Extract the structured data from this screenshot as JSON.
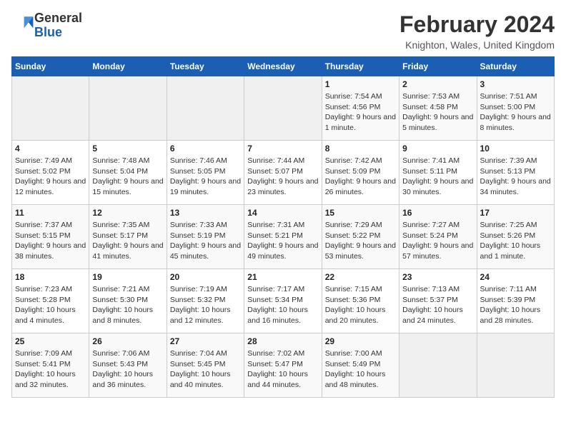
{
  "header": {
    "logo_general": "General",
    "logo_blue": "Blue",
    "month_title": "February 2024",
    "location": "Knighton, Wales, United Kingdom"
  },
  "days_of_week": [
    "Sunday",
    "Monday",
    "Tuesday",
    "Wednesday",
    "Thursday",
    "Friday",
    "Saturday"
  ],
  "weeks": [
    [
      {
        "day": "",
        "info": ""
      },
      {
        "day": "",
        "info": ""
      },
      {
        "day": "",
        "info": ""
      },
      {
        "day": "",
        "info": ""
      },
      {
        "day": "1",
        "info": "Sunrise: 7:54 AM\nSunset: 4:56 PM\nDaylight: 9 hours and 1 minute."
      },
      {
        "day": "2",
        "info": "Sunrise: 7:53 AM\nSunset: 4:58 PM\nDaylight: 9 hours and 5 minutes."
      },
      {
        "day": "3",
        "info": "Sunrise: 7:51 AM\nSunset: 5:00 PM\nDaylight: 9 hours and 8 minutes."
      }
    ],
    [
      {
        "day": "4",
        "info": "Sunrise: 7:49 AM\nSunset: 5:02 PM\nDaylight: 9 hours and 12 minutes."
      },
      {
        "day": "5",
        "info": "Sunrise: 7:48 AM\nSunset: 5:04 PM\nDaylight: 9 hours and 15 minutes."
      },
      {
        "day": "6",
        "info": "Sunrise: 7:46 AM\nSunset: 5:05 PM\nDaylight: 9 hours and 19 minutes."
      },
      {
        "day": "7",
        "info": "Sunrise: 7:44 AM\nSunset: 5:07 PM\nDaylight: 9 hours and 23 minutes."
      },
      {
        "day": "8",
        "info": "Sunrise: 7:42 AM\nSunset: 5:09 PM\nDaylight: 9 hours and 26 minutes."
      },
      {
        "day": "9",
        "info": "Sunrise: 7:41 AM\nSunset: 5:11 PM\nDaylight: 9 hours and 30 minutes."
      },
      {
        "day": "10",
        "info": "Sunrise: 7:39 AM\nSunset: 5:13 PM\nDaylight: 9 hours and 34 minutes."
      }
    ],
    [
      {
        "day": "11",
        "info": "Sunrise: 7:37 AM\nSunset: 5:15 PM\nDaylight: 9 hours and 38 minutes."
      },
      {
        "day": "12",
        "info": "Sunrise: 7:35 AM\nSunset: 5:17 PM\nDaylight: 9 hours and 41 minutes."
      },
      {
        "day": "13",
        "info": "Sunrise: 7:33 AM\nSunset: 5:19 PM\nDaylight: 9 hours and 45 minutes."
      },
      {
        "day": "14",
        "info": "Sunrise: 7:31 AM\nSunset: 5:21 PM\nDaylight: 9 hours and 49 minutes."
      },
      {
        "day": "15",
        "info": "Sunrise: 7:29 AM\nSunset: 5:22 PM\nDaylight: 9 hours and 53 minutes."
      },
      {
        "day": "16",
        "info": "Sunrise: 7:27 AM\nSunset: 5:24 PM\nDaylight: 9 hours and 57 minutes."
      },
      {
        "day": "17",
        "info": "Sunrise: 7:25 AM\nSunset: 5:26 PM\nDaylight: 10 hours and 1 minute."
      }
    ],
    [
      {
        "day": "18",
        "info": "Sunrise: 7:23 AM\nSunset: 5:28 PM\nDaylight: 10 hours and 4 minutes."
      },
      {
        "day": "19",
        "info": "Sunrise: 7:21 AM\nSunset: 5:30 PM\nDaylight: 10 hours and 8 minutes."
      },
      {
        "day": "20",
        "info": "Sunrise: 7:19 AM\nSunset: 5:32 PM\nDaylight: 10 hours and 12 minutes."
      },
      {
        "day": "21",
        "info": "Sunrise: 7:17 AM\nSunset: 5:34 PM\nDaylight: 10 hours and 16 minutes."
      },
      {
        "day": "22",
        "info": "Sunrise: 7:15 AM\nSunset: 5:36 PM\nDaylight: 10 hours and 20 minutes."
      },
      {
        "day": "23",
        "info": "Sunrise: 7:13 AM\nSunset: 5:37 PM\nDaylight: 10 hours and 24 minutes."
      },
      {
        "day": "24",
        "info": "Sunrise: 7:11 AM\nSunset: 5:39 PM\nDaylight: 10 hours and 28 minutes."
      }
    ],
    [
      {
        "day": "25",
        "info": "Sunrise: 7:09 AM\nSunset: 5:41 PM\nDaylight: 10 hours and 32 minutes."
      },
      {
        "day": "26",
        "info": "Sunrise: 7:06 AM\nSunset: 5:43 PM\nDaylight: 10 hours and 36 minutes."
      },
      {
        "day": "27",
        "info": "Sunrise: 7:04 AM\nSunset: 5:45 PM\nDaylight: 10 hours and 40 minutes."
      },
      {
        "day": "28",
        "info": "Sunrise: 7:02 AM\nSunset: 5:47 PM\nDaylight: 10 hours and 44 minutes."
      },
      {
        "day": "29",
        "info": "Sunrise: 7:00 AM\nSunset: 5:49 PM\nDaylight: 10 hours and 48 minutes."
      },
      {
        "day": "",
        "info": ""
      },
      {
        "day": "",
        "info": ""
      }
    ]
  ]
}
